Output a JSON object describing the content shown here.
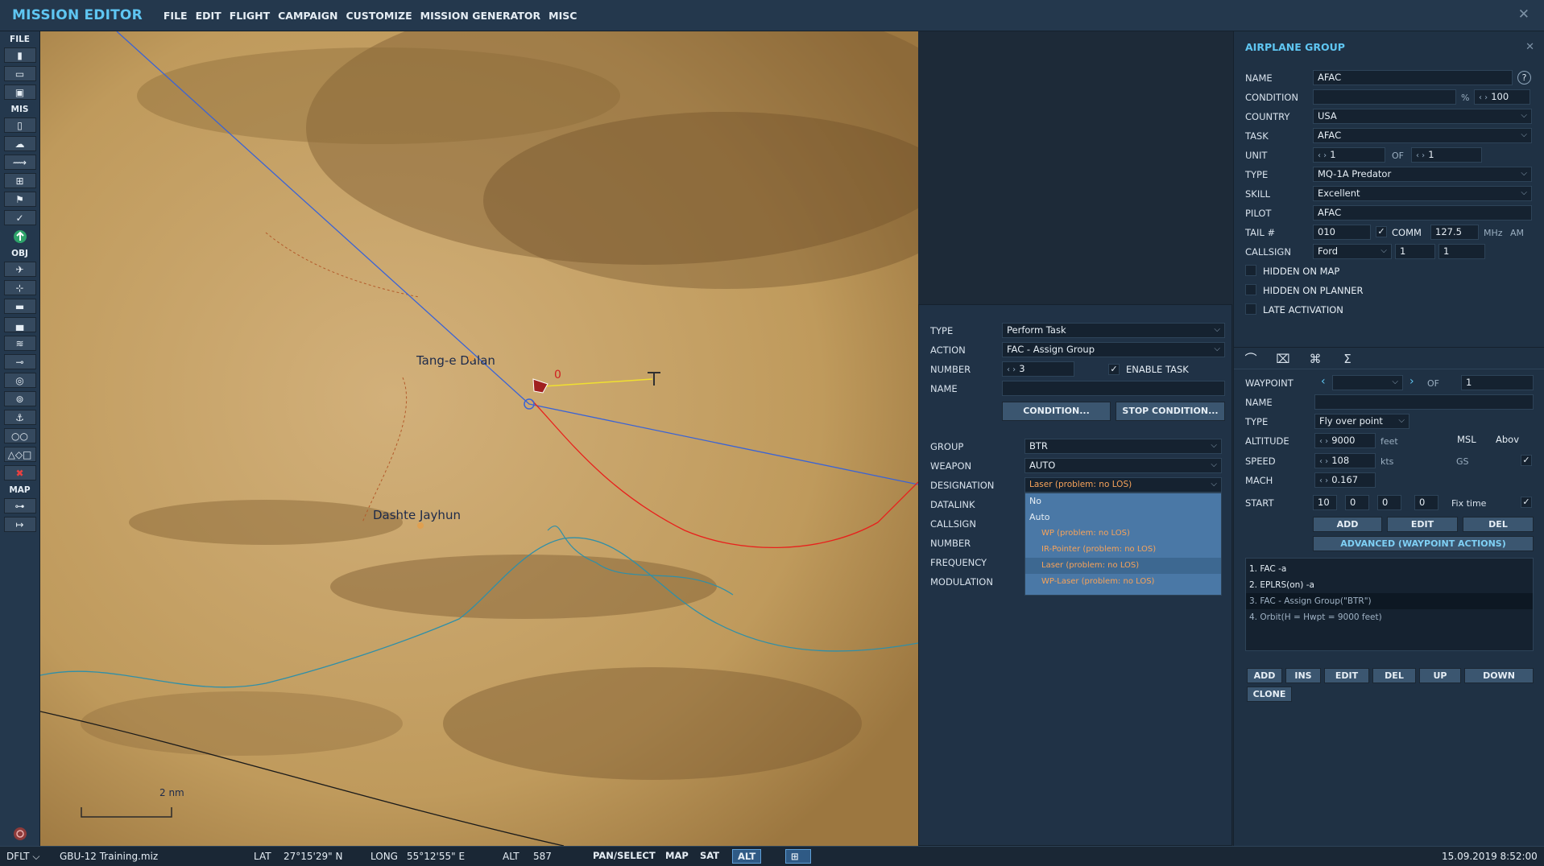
{
  "app": {
    "title": "MISSION EDITOR",
    "close": "✕"
  },
  "menu": [
    "FILE",
    "EDIT",
    "FLIGHT",
    "CAMPAIGN",
    "CUSTOMIZE",
    "MISSION GENERATOR",
    "MISC"
  ],
  "toolbar": {
    "sections": {
      "file": "FILE",
      "mis": "MIS",
      "obj": "OBJ",
      "map": "MAP"
    }
  },
  "map": {
    "labels": {
      "town1": "Tang-e Dalan",
      "town2": "Dashte Jayhun",
      "wp_index": "0",
      "scale": "2 nm"
    },
    "colors": {
      "route": "#3a63d6",
      "red_line": "#e8201c",
      "yellow_line": "#f0e030",
      "river": "#2f8fa8",
      "border": "#1a1a1a",
      "terrain": "#caa461"
    }
  },
  "group": {
    "header": "AIRPLANE GROUP",
    "close": "✕",
    "labels": {
      "name": "NAME",
      "condition": "CONDITION",
      "country": "COUNTRY",
      "task": "TASK",
      "unit": "UNIT",
      "type": "TYPE",
      "skill": "SKILL",
      "pilot": "PILOT",
      "tail": "TAIL #",
      "callsign": "CALLSIGN",
      "hidden_map": "HIDDEN ON MAP",
      "hidden_planner": "HIDDEN ON PLANNER",
      "late_activation": "LATE ACTIVATION",
      "of": "OF",
      "comm": "COMM",
      "pct": "%",
      "mhz": "MHz",
      "am": "AM",
      "help": "?"
    },
    "values": {
      "name": "AFAC",
      "condition_pct": "100",
      "country": "USA",
      "task": "AFAC",
      "unit": "1",
      "unit_of": "1",
      "type": "MQ-1A Predator",
      "skill": "Excellent",
      "pilot": "AFAC",
      "tail": "010",
      "comm_freq": "127.5",
      "callsign_name": "Ford",
      "callsign_n1": "1",
      "callsign_n2": "1"
    }
  },
  "waypoint": {
    "labels": {
      "waypoint": "WAYPOINT",
      "of": "OF",
      "name": "NAME",
      "type": "TYPE",
      "altitude": "ALTITUDE",
      "speed": "SPEED",
      "mach": "MACH",
      "start": "START",
      "feet": "feet",
      "kts": "kts",
      "gs": "GS",
      "fix_time": "Fix time",
      "msl": "MSL",
      "above": "Abov"
    },
    "values": {
      "of": "1",
      "type": "Fly over point",
      "altitude": "9000",
      "speed": "108",
      "mach": "0.167",
      "start_d": "10",
      "start_h": "0",
      "start_m": "0",
      "start_s": "0"
    },
    "buttons": {
      "add": "ADD",
      "edit": "EDIT",
      "del": "DEL",
      "advanced": "ADVANCED (WAYPOINT ACTIONS)"
    },
    "actions": [
      "1. FAC -a",
      "2. EPLRS(on) -a",
      "3. FAC - Assign Group(\"BTR\")",
      "4. Orbit(H = Hwpt = 9000 feet)"
    ],
    "action_buttons": {
      "add": "ADD",
      "ins": "INS",
      "edit": "EDIT",
      "del": "DEL",
      "up": "UP",
      "down": "DOWN",
      "clone": "CLONE"
    }
  },
  "task": {
    "labels": {
      "type": "TYPE",
      "action": "ACTION",
      "number": "NUMBER",
      "name": "NAME",
      "enable": "ENABLE TASK",
      "group": "GROUP",
      "weapon": "WEAPON",
      "designation": "DESIGNATION",
      "datalink": "DATALINK",
      "callsign": "CALLSIGN",
      "number2": "NUMBER",
      "frequency": "FREQUENCY",
      "modulation": "MODULATION"
    },
    "values": {
      "type": "Perform Task",
      "action": "FAC - Assign Group",
      "number": "3",
      "group": "BTR",
      "weapon": "AUTO",
      "designation": "Laser (problem: no LOS)"
    },
    "buttons": {
      "condition": "CONDITION...",
      "stop_condition": "STOP CONDITION..."
    },
    "designation_options": [
      "No",
      "Auto",
      "WP (problem: no LOS)",
      "IR-Pointer (problem: no LOS)",
      "Laser (problem: no LOS)",
      "WP-Laser (problem: no LOS)"
    ]
  },
  "status": {
    "mode": "DFLT",
    "file": "GBU-12 Training.miz",
    "lat_label": "LAT",
    "lat": "27°15'29\" N",
    "long_label": "LONG",
    "long": "55°12'55\" E",
    "alt_label": "ALT",
    "alt": "587",
    "pan": "PAN/SELECT",
    "map": "MAP",
    "sat": "SAT",
    "altbtn": "ALT",
    "datetime": "15.09.2019 8:52:00"
  }
}
